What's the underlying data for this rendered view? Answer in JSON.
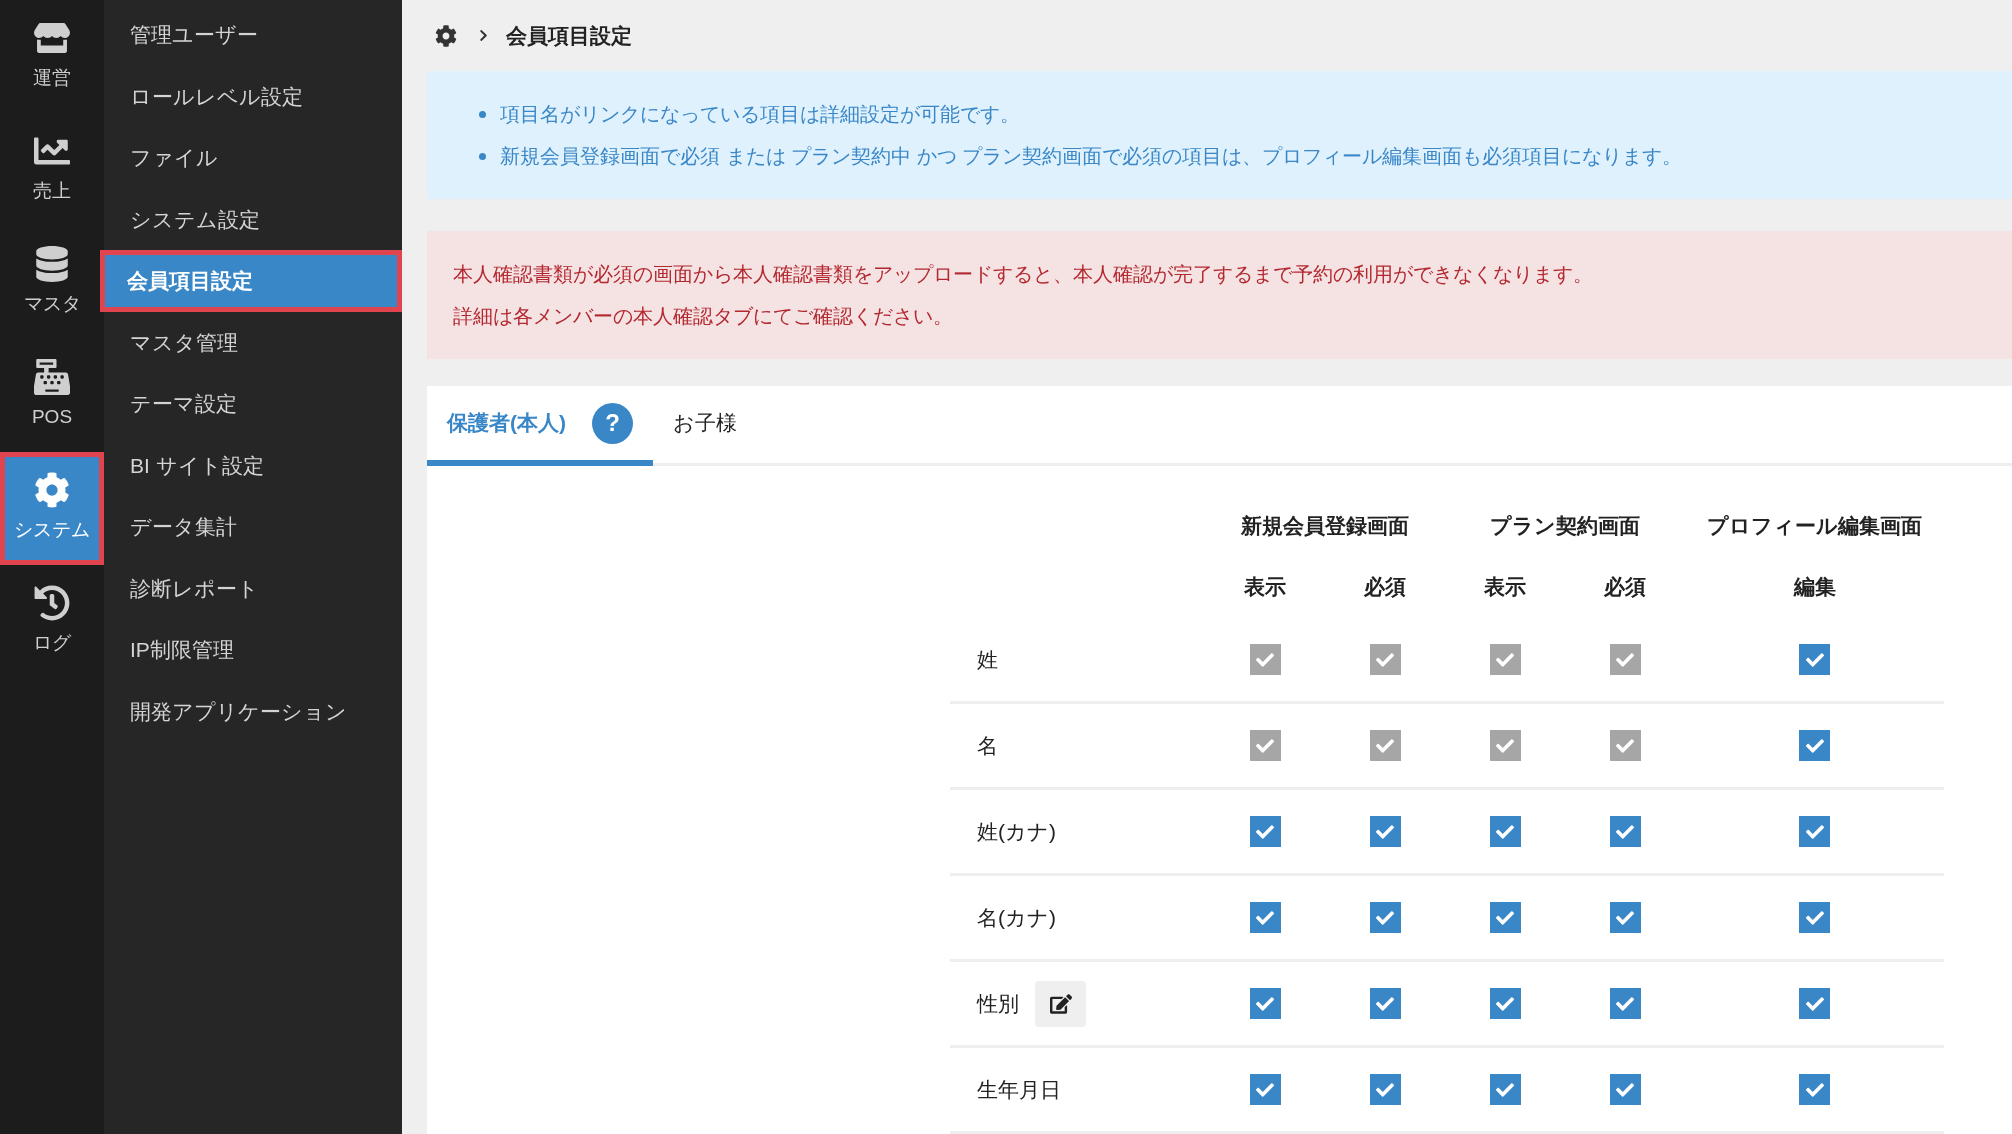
{
  "rail": [
    {
      "label": "運営",
      "selected": false
    },
    {
      "label": "売上",
      "selected": false
    },
    {
      "label": "マスタ",
      "selected": false
    },
    {
      "label": "POS",
      "selected": false
    },
    {
      "label": "システム",
      "selected": true
    },
    {
      "label": "ログ",
      "selected": false
    }
  ],
  "sidebar": {
    "items": [
      {
        "label": "管理ユーザー",
        "selected": false
      },
      {
        "label": "ロールレベル設定",
        "selected": false
      },
      {
        "label": "ファイル",
        "selected": false
      },
      {
        "label": "システム設定",
        "selected": false
      },
      {
        "label": "会員項目設定",
        "selected": true
      },
      {
        "label": "マスタ管理",
        "selected": false
      },
      {
        "label": "テーマ設定",
        "selected": false
      },
      {
        "label": "BI サイト設定",
        "selected": false
      },
      {
        "label": "データ集計",
        "selected": false
      },
      {
        "label": "診断レポート",
        "selected": false
      },
      {
        "label": "IP制限管理",
        "selected": false
      },
      {
        "label": "開発アプリケーション",
        "selected": false
      }
    ]
  },
  "breadcrumb": {
    "current": "会員項目設定"
  },
  "info": [
    "項目名がリンクになっている項目は詳細設定が可能です。",
    "新規会員登録画面で必須 または プラン契約中 かつ プラン契約画面で必須の項目は、プロフィール編集画面も必須項目になります。"
  ],
  "alert": [
    "本人確認書類が必須の画面から本人確認書類をアップロードすると、本人確認が完了するまで予約の利用ができなくなります。",
    "詳細は各メンバーの本人確認タブにてご確認ください。"
  ],
  "tabs": [
    {
      "label": "保護者(本人)",
      "selected": true,
      "help": "?"
    },
    {
      "label": "お子様",
      "selected": false
    }
  ],
  "table": {
    "groups": [
      "新規会員登録画面",
      "プラン契約画面",
      "プロフィール編集画面"
    ],
    "columns": [
      "表示",
      "必須",
      "表示",
      "必須",
      "編集"
    ],
    "rows": [
      {
        "label": "姓",
        "editable": false,
        "cells": [
          {
            "checked": true,
            "disabled": true
          },
          {
            "checked": true,
            "disabled": true
          },
          {
            "checked": true,
            "disabled": true
          },
          {
            "checked": true,
            "disabled": true
          },
          {
            "checked": true,
            "disabled": false
          }
        ]
      },
      {
        "label": "名",
        "editable": false,
        "cells": [
          {
            "checked": true,
            "disabled": true
          },
          {
            "checked": true,
            "disabled": true
          },
          {
            "checked": true,
            "disabled": true
          },
          {
            "checked": true,
            "disabled": true
          },
          {
            "checked": true,
            "disabled": false
          }
        ]
      },
      {
        "label": "姓(カナ)",
        "editable": false,
        "cells": [
          {
            "checked": true,
            "disabled": false
          },
          {
            "checked": true,
            "disabled": false
          },
          {
            "checked": true,
            "disabled": false
          },
          {
            "checked": true,
            "disabled": false
          },
          {
            "checked": true,
            "disabled": false
          }
        ]
      },
      {
        "label": "名(カナ)",
        "editable": false,
        "cells": [
          {
            "checked": true,
            "disabled": false
          },
          {
            "checked": true,
            "disabled": false
          },
          {
            "checked": true,
            "disabled": false
          },
          {
            "checked": true,
            "disabled": false
          },
          {
            "checked": true,
            "disabled": false
          }
        ]
      },
      {
        "label": "性別",
        "editable": true,
        "cells": [
          {
            "checked": true,
            "disabled": false
          },
          {
            "checked": true,
            "disabled": false
          },
          {
            "checked": true,
            "disabled": false
          },
          {
            "checked": true,
            "disabled": false
          },
          {
            "checked": true,
            "disabled": false
          }
        ]
      },
      {
        "label": "生年月日",
        "editable": false,
        "cells": [
          {
            "checked": true,
            "disabled": false
          },
          {
            "checked": true,
            "disabled": false
          },
          {
            "checked": true,
            "disabled": false
          },
          {
            "checked": true,
            "disabled": false
          },
          {
            "checked": true,
            "disabled": false
          }
        ]
      }
    ]
  }
}
